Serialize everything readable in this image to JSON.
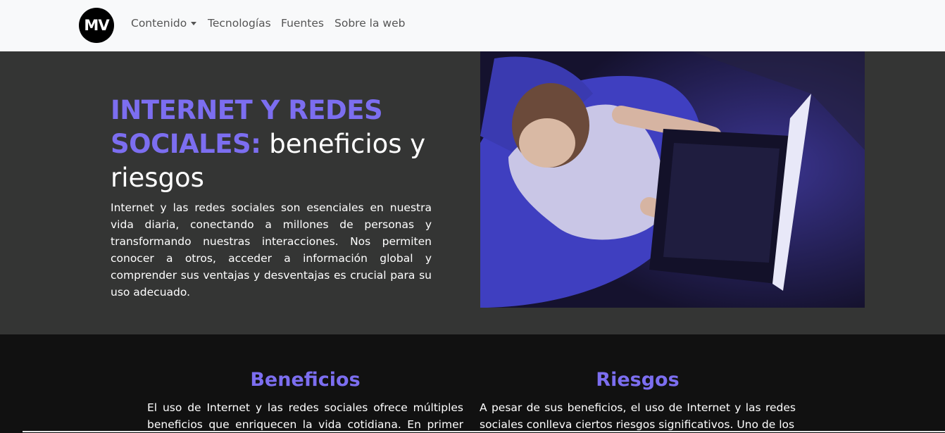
{
  "navbar": {
    "logo_text": "MV",
    "links": [
      {
        "label": "Contenido",
        "dropdown": true
      },
      {
        "label": "Tecnologías"
      },
      {
        "label": "Fuentes"
      },
      {
        "label": "Sobre la web"
      }
    ]
  },
  "hero": {
    "title_accent_1": "INTERNET Y REDES",
    "title_accent_2": "SOCIALES:",
    "title_rest_1": " beneficios y",
    "title_rest_2": "riesgos",
    "paragraph": "Internet y las redes sociales son esenciales en nuestra vida diaria, conectando a millones de personas y transformando nuestras interacciones. Nos permiten conocer a otros, acceder a información global y comprender sus ventajas y desventajas es crucial para su uso adecuado."
  },
  "sections": {
    "benefits": {
      "title": "Beneficios",
      "text": "El uso de Internet y las redes sociales ofrece múltiples beneficios que enriquecen la vida cotidiana. En primer lugar,"
    },
    "risks": {
      "title": "Riesgos",
      "text": "A pesar de sus beneficios, el uso de Internet y las redes sociales conlleva ciertos riesgos significativos. Uno de los"
    }
  },
  "colors": {
    "accent": "#7c6ef0",
    "navbar_bg": "#f8f9fa",
    "hero_bg": "#343534",
    "section_bg": "#111111"
  }
}
